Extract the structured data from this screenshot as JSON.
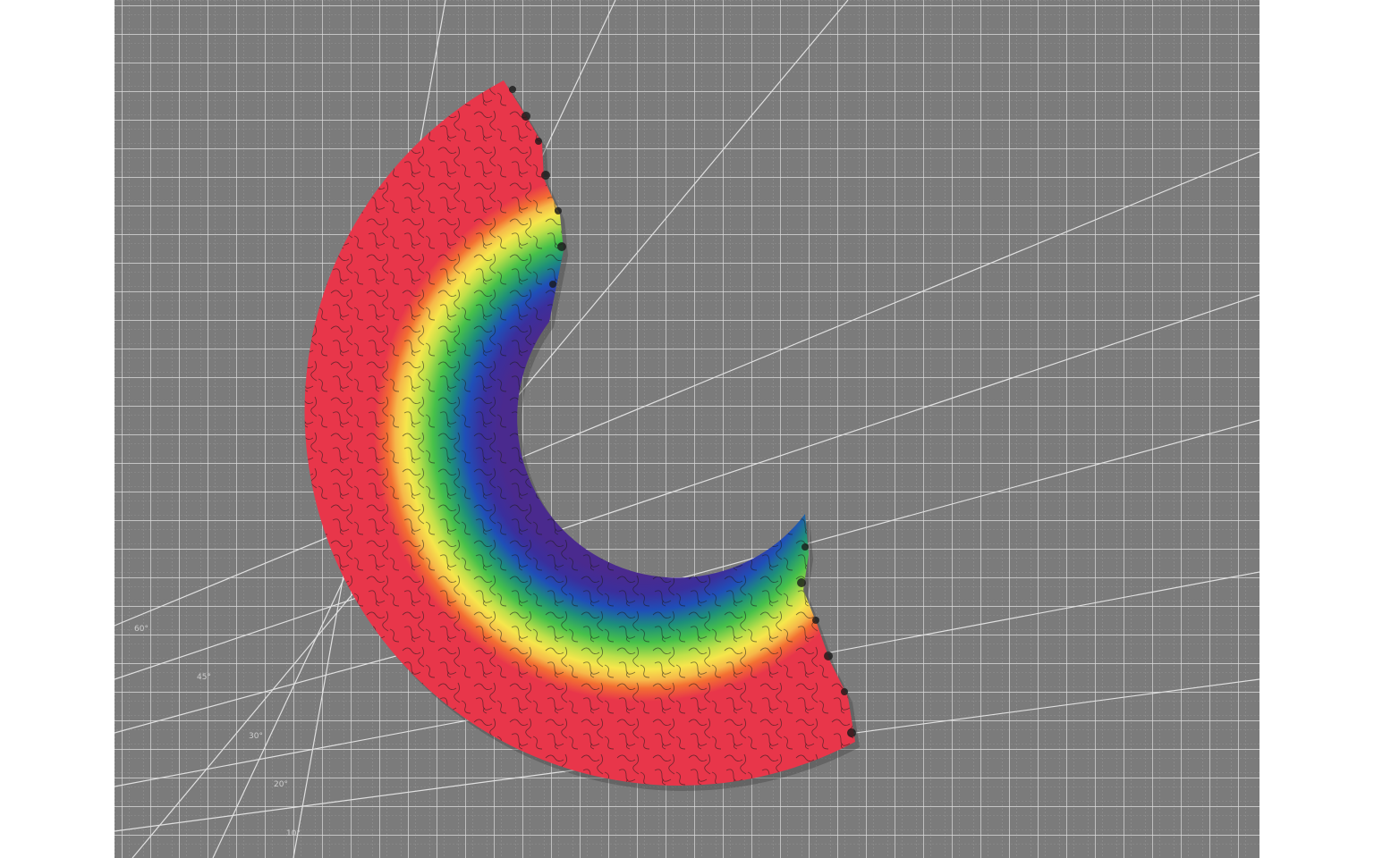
{
  "scene": {
    "subject": "rainbow-jigsaw-puzzle-arc",
    "surface": "cutting-mat",
    "colors": {
      "mat": "#7b7b7b",
      "grid_line": "#d8d8d8",
      "frame": "#ffffff",
      "red": "#e8364a",
      "orange": "#f37032",
      "yellow": "#f6e64c",
      "green": "#47c14a",
      "blue": "#1f4fb8",
      "indigo": "#3b2f9c",
      "violet": "#4a2a8e",
      "cut_line": "#1a1a1a"
    }
  },
  "mat_labels": {
    "l60": "60°",
    "l45": "45°",
    "l30": "30°",
    "l20": "20°",
    "l10": "10°"
  }
}
